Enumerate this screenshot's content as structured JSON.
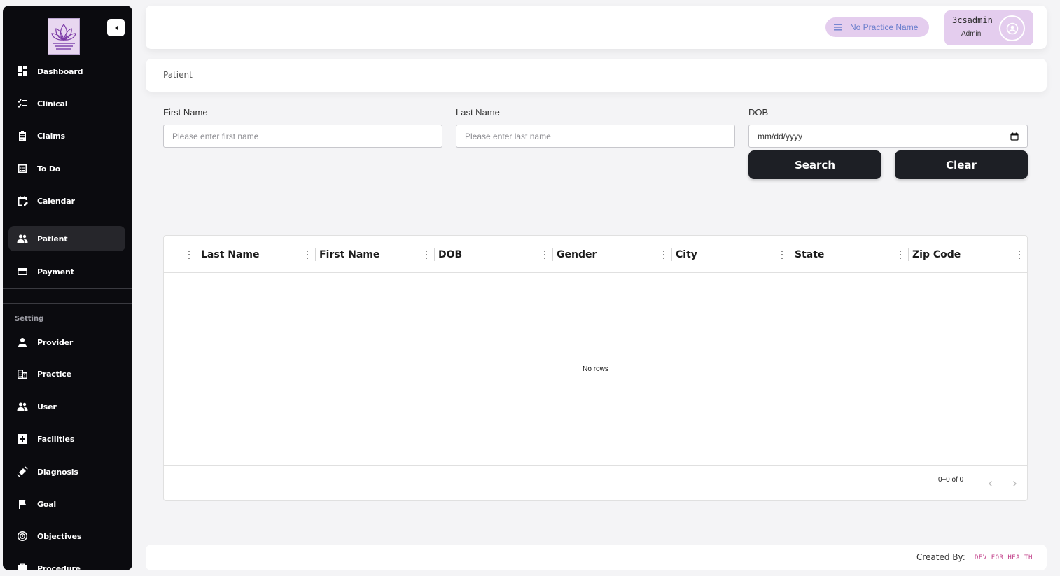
{
  "sidebar": {
    "logo_icon": "lotus-logo",
    "nav": [
      {
        "label": "Dashboard",
        "icon": "dashboard-icon"
      },
      {
        "label": "Clinical",
        "icon": "checklist-icon"
      },
      {
        "label": "Claims",
        "icon": "clipboard-icon"
      },
      {
        "label": "To Do",
        "icon": "list-icon"
      },
      {
        "label": "Calendar",
        "icon": "calendar-edit-icon"
      },
      {
        "label": "Patient",
        "icon": "people-icon",
        "active": true
      },
      {
        "label": "Payment",
        "icon": "credit-card-icon"
      }
    ],
    "setting_heading": "Setting",
    "settings": [
      {
        "label": "Provider",
        "icon": "person-icon"
      },
      {
        "label": "Practice",
        "icon": "building-icon"
      },
      {
        "label": "User",
        "icon": "people-icon"
      },
      {
        "label": "Facilities",
        "icon": "medical-plus-icon"
      },
      {
        "label": "Diagnosis",
        "icon": "bandage-icon"
      },
      {
        "label": "Goal",
        "icon": "flag-icon"
      },
      {
        "label": "Objectives",
        "icon": "target-icon"
      },
      {
        "label": "Procedure",
        "icon": "briefcase-medical-icon"
      }
    ]
  },
  "header": {
    "practice_chip": "No Practice Name",
    "user": {
      "name": "3csadmin",
      "role": "Admin"
    }
  },
  "breadcrumb": {
    "title": "Patient"
  },
  "filters": {
    "first_name": {
      "label": "First Name",
      "placeholder": "Please enter first name",
      "value": ""
    },
    "last_name": {
      "label": "Last Name",
      "placeholder": "Please enter last name",
      "value": ""
    },
    "dob": {
      "label": "DOB",
      "placeholder": "mm/dd/yyyy"
    },
    "search_label": "Search",
    "clear_label": "Clear"
  },
  "grid": {
    "columns": [
      "Last Name",
      "First Name",
      "DOB",
      "Gender",
      "City",
      "State",
      "Zip Code"
    ],
    "rows": [],
    "empty_text": "No rows",
    "pagination": "0–0 of 0"
  },
  "footer": {
    "created_by": "Created By:",
    "brand": "DEV FOR HEALTH"
  },
  "colors": {
    "sidebar_bg": "#0b0b0f",
    "accent_chip": "#e4cdee",
    "button_bg": "#1d1f25",
    "brand_pink": "#c2408a"
  }
}
